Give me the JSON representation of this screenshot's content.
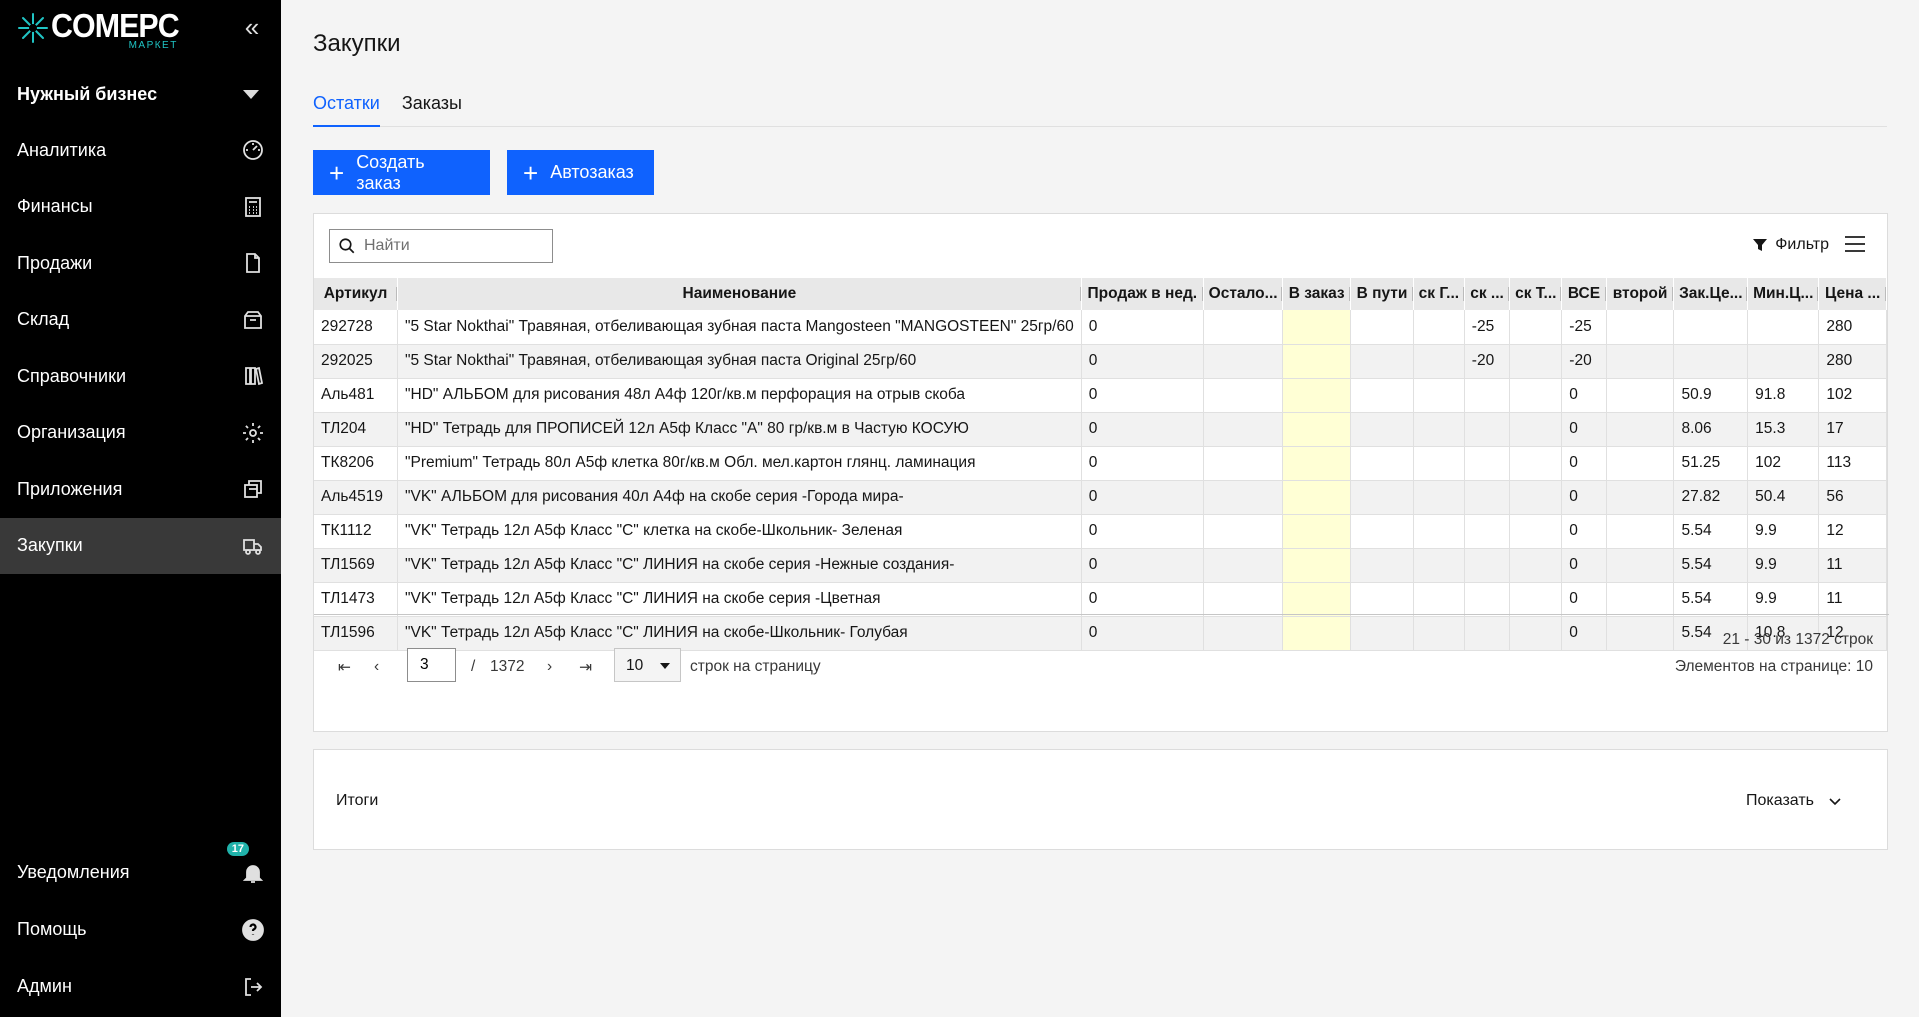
{
  "app": {
    "logo_main": "COMEPC",
    "logo_sub": "МАРКЕТ",
    "business": "Нужный бизнес"
  },
  "nav": [
    {
      "label": "Аналитика",
      "icon": "speedometer-icon"
    },
    {
      "label": "Финансы",
      "icon": "calculator-icon"
    },
    {
      "label": "Продажи",
      "icon": "document-icon"
    },
    {
      "label": "Склад",
      "icon": "box-icon"
    },
    {
      "label": "Справочники",
      "icon": "books-icon"
    },
    {
      "label": "Организация",
      "icon": "gear-icon"
    },
    {
      "label": "Приложения",
      "icon": "windows-icon"
    },
    {
      "label": "Закупки",
      "icon": "truck-icon",
      "active": true
    }
  ],
  "bottom_nav": {
    "notifications": {
      "label": "Уведомления",
      "badge": "17"
    },
    "help": {
      "label": "Помощь"
    },
    "admin": {
      "label": "Админ"
    }
  },
  "page": {
    "title": "Закупки",
    "tabs": [
      "Остатки",
      "Заказы"
    ],
    "active_tab": 0,
    "create_order": "Создать заказ",
    "auto_order": "Автозаказ"
  },
  "toolbar": {
    "search_placeholder": "Найти",
    "filter_label": "Фильтр"
  },
  "table": {
    "columns": [
      "Артикул",
      "Наименование",
      "Продаж в нед.",
      "Остало...",
      "В заказ",
      "В пути",
      "ск Г...",
      "ск ...",
      "ск Т...",
      "ВСЕ",
      "второй",
      "Зак.Це...",
      "Мин.Ц...",
      "Цена ..."
    ],
    "rows": [
      [
        "292728",
        "\"5 Star Nokthai\" Травяная, отбеливающая зубная паста Mangosteen \"MANGOSTEEN\" 25гр/60",
        "0",
        "",
        "",
        "",
        "",
        "-25",
        "",
        "-25",
        "",
        "",
        "",
        "280"
      ],
      [
        "292025",
        "\"5 Star Nokthai\" Травяная, отбеливающая зубная паста Original 25гр/60",
        "0",
        "",
        "",
        "",
        "",
        "-20",
        "",
        "-20",
        "",
        "",
        "",
        "280"
      ],
      [
        "Аль481",
        "\"HD\" АЛЬБОМ для рисования 48л А4ф 120г/кв.м перфорация на отрыв скоба",
        "0",
        "",
        "",
        "",
        "",
        "",
        "",
        "0",
        "",
        "50.9",
        "91.8",
        "102"
      ],
      [
        "ТЛ204",
        "\"HD\" Тетрадь для ПРОПИСЕЙ 12л А5ф Класс \"А\" 80 гр/кв.м в Частую КОСУЮ",
        "0",
        "",
        "",
        "",
        "",
        "",
        "",
        "0",
        "",
        "8.06",
        "15.3",
        "17"
      ],
      [
        "ТК8206",
        "\"Premium\" Тетрадь 80л А5ф клетка 80г/кв.м Обл. мел.картон глянц. ламинация",
        "0",
        "",
        "",
        "",
        "",
        "",
        "",
        "0",
        "",
        "51.25",
        "102",
        "113"
      ],
      [
        "Аль4519",
        "\"VK\" АЛЬБОМ для рисования 40л А4ф на скобе серия -Города мира-",
        "0",
        "",
        "",
        "",
        "",
        "",
        "",
        "0",
        "",
        "27.82",
        "50.4",
        "56"
      ],
      [
        "ТК1112",
        "\"VK\" Тетрадь 12л А5ф Класс \"С\" клетка на скобе-Школьник- Зеленая",
        "0",
        "",
        "",
        "",
        "",
        "",
        "",
        "0",
        "",
        "5.54",
        "9.9",
        "12"
      ],
      [
        "ТЛ1569",
        "\"VK\" Тетрадь 12л А5ф Класс \"С\" ЛИНИЯ на скобе серия -Нежные создания-",
        "0",
        "",
        "",
        "",
        "",
        "",
        "",
        "0",
        "",
        "5.54",
        "9.9",
        "11"
      ],
      [
        "ТЛ1473",
        "\"VK\" Тетрадь 12л А5ф Класс \"С\" ЛИНИЯ на скобе серия -Цветная",
        "0",
        "",
        "",
        "",
        "",
        "",
        "",
        "0",
        "",
        "5.54",
        "9.9",
        "11"
      ],
      [
        "ТЛ1596",
        "\"VK\" Тетрадь 12л А5ф Класс \"С\" ЛИНИЯ на скобе-Школьник- Голубая",
        "0",
        "",
        "",
        "",
        "",
        "",
        "",
        "0",
        "",
        "5.54",
        "10.8",
        "12"
      ]
    ]
  },
  "pagination": {
    "page": "3",
    "slash": "/",
    "total_pages": "1372",
    "page_size": "10",
    "page_size_label": "строк на страницу",
    "range": "21 - 30 из 1372 строк",
    "per_page": "Элементов на странице: 10"
  },
  "totals": {
    "label": "Итоги",
    "show": "Показать"
  }
}
